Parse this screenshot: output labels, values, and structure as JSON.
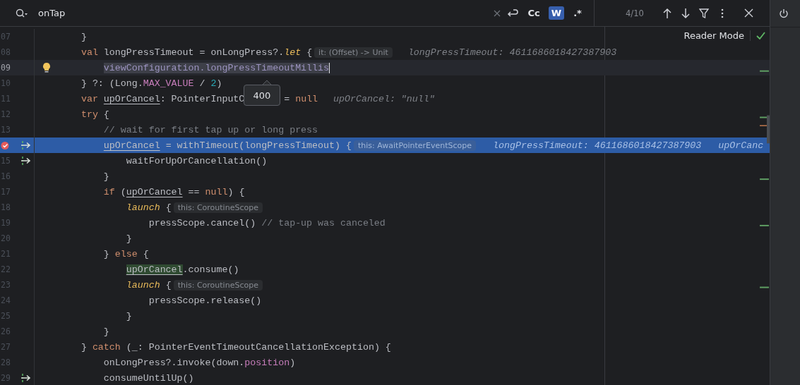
{
  "search": {
    "value": "onTap",
    "options": [
      {
        "label": "Cc",
        "selected": false
      },
      {
        "label": "W",
        "selected": true
      },
      {
        "label": ".*",
        "selected": false
      }
    ],
    "count": "4/10"
  },
  "reader_mode": {
    "label": "Reader Mode"
  },
  "tooltip": {
    "text": "400"
  },
  "lines": [
    {
      "number": "07",
      "current": false,
      "execution": false,
      "code": [
        {
          "kind": "plain",
          "text": "    }"
        }
      ]
    },
    {
      "number": "08",
      "current": false,
      "execution": false,
      "code": [
        {
          "kind": "keyword",
          "text": "    val "
        },
        {
          "kind": "plain",
          "text": "longPressTimeout = onLongPress?."
        },
        {
          "kind": "call",
          "text": "let"
        },
        {
          "kind": "plain",
          "text": " {"
        },
        {
          "kind": "hint",
          "text": "it: (Offset) -> Unit"
        },
        {
          "kind": "debug",
          "text": "longPressTimeout: 4611686018427387903"
        }
      ]
    },
    {
      "number": "09",
      "current": true,
      "execution": false,
      "markers": [
        {
          "kind": "bulb"
        }
      ],
      "code": [
        {
          "kind": "selected",
          "text": "        viewConfiguration.longPressTimeoutMillis"
        }
      ]
    },
    {
      "number": "10",
      "current": false,
      "execution": false,
      "code": [
        {
          "kind": "plain",
          "text": "    } ?: (Long."
        },
        {
          "kind": "constant",
          "text": "MAX_VALUE"
        },
        {
          "kind": "plain",
          "text": " / "
        },
        {
          "kind": "number",
          "text": "2"
        },
        {
          "kind": "plain",
          "text": ")"
        }
      ]
    },
    {
      "number": "11",
      "current": false,
      "execution": false,
      "code": [
        {
          "kind": "keyword",
          "text": "    var "
        },
        {
          "kind": "variable",
          "text": "upOrCancel"
        },
        {
          "kind": "plain",
          "text": ": PointerInputC"
        },
        {
          "kind": "plain",
          "text": "       = "
        },
        {
          "kind": "keyword",
          "text": "null"
        },
        {
          "kind": "debug",
          "text": "upOrCancel: \"null\""
        }
      ]
    },
    {
      "number": "12",
      "current": false,
      "execution": false,
      "code": [
        {
          "kind": "keyword",
          "text": "    try"
        },
        {
          "kind": "plain",
          "text": " {"
        }
      ]
    },
    {
      "number": "13",
      "current": false,
      "execution": false,
      "code": [
        {
          "kind": "comment",
          "text": "        // wait for first tap up or long press"
        }
      ]
    },
    {
      "current": false,
      "execution": true,
      "markers": [
        {
          "kind": "breakpoint"
        },
        {
          "kind": "step"
        }
      ],
      "code": [
        {
          "kind": "variable",
          "text": "        upOrCancel"
        },
        {
          "kind": "plain",
          "text": " = withTimeout(longPressTimeout) {"
        },
        {
          "kind": "hint",
          "text": "this: AwaitPointerEventScope"
        },
        {
          "kind": "debug",
          "text": "longPressTimeout: 4611686018427387903"
        },
        {
          "kind": "debug",
          "text": "upOrCanc"
        }
      ]
    },
    {
      "number": "15",
      "current": false,
      "execution": false,
      "markers": [
        {
          "kind": "step"
        }
      ],
      "code": [
        {
          "kind": "plain",
          "text": "            waitForUpOrCancellation()"
        }
      ]
    },
    {
      "number": "16",
      "current": false,
      "execution": false,
      "code": [
        {
          "kind": "plain",
          "text": "        }"
        }
      ]
    },
    {
      "number": "17",
      "current": false,
      "execution": false,
      "code": [
        {
          "kind": "keyword",
          "text": "        if"
        },
        {
          "kind": "plain",
          "text": " ("
        },
        {
          "kind": "variable",
          "text": "upOrCancel"
        },
        {
          "kind": "plain",
          "text": " == "
        },
        {
          "kind": "keyword",
          "text": "null"
        },
        {
          "kind": "plain",
          "text": ") {"
        }
      ]
    },
    {
      "number": "18",
      "current": false,
      "execution": false,
      "code": [
        {
          "kind": "call",
          "text": "            launch"
        },
        {
          "kind": "plain",
          "text": " {"
        },
        {
          "kind": "hint",
          "text": "this: CoroutineScope"
        }
      ]
    },
    {
      "number": "19",
      "current": false,
      "execution": false,
      "code": [
        {
          "kind": "plain",
          "text": "                pressScope.cancel() "
        },
        {
          "kind": "comment",
          "text": "// tap-up was canceled"
        }
      ]
    },
    {
      "number": "20",
      "current": false,
      "execution": false,
      "code": [
        {
          "kind": "plain",
          "text": "            }"
        }
      ]
    },
    {
      "number": "21",
      "current": false,
      "execution": false,
      "code": [
        {
          "kind": "plain",
          "text": "        } "
        },
        {
          "kind": "keyword",
          "text": "else"
        },
        {
          "kind": "plain",
          "text": " {"
        }
      ]
    },
    {
      "number": "22",
      "current": false,
      "execution": false,
      "code": [
        {
          "kind": "match",
          "text": "            upOrCancel"
        },
        {
          "kind": "plain",
          "text": ".consume()"
        }
      ]
    },
    {
      "number": "23",
      "current": false,
      "execution": false,
      "code": [
        {
          "kind": "call",
          "text": "            launch"
        },
        {
          "kind": "plain",
          "text": " {"
        },
        {
          "kind": "hint",
          "text": "this: CoroutineScope"
        }
      ]
    },
    {
      "number": "24",
      "current": false,
      "execution": false,
      "code": [
        {
          "kind": "plain",
          "text": "                pressScope.release()"
        }
      ]
    },
    {
      "number": "25",
      "current": false,
      "execution": false,
      "code": [
        {
          "kind": "plain",
          "text": "            }"
        }
      ]
    },
    {
      "number": "26",
      "current": false,
      "execution": false,
      "code": [
        {
          "kind": "plain",
          "text": "        }"
        }
      ]
    },
    {
      "number": "27",
      "current": false,
      "execution": false,
      "code": [
        {
          "kind": "plain",
          "text": "    } "
        },
        {
          "kind": "keyword",
          "text": "catch"
        },
        {
          "kind": "plain",
          "text": " (_: PointerEventTimeoutCancellationException) {"
        }
      ]
    },
    {
      "number": "28",
      "current": false,
      "execution": false,
      "code": [
        {
          "kind": "plain",
          "text": "        onLongPress?.invoke(down."
        },
        {
          "kind": "constant",
          "text": "position"
        },
        {
          "kind": "plain",
          "text": ")"
        }
      ]
    },
    {
      "number": "29",
      "current": false,
      "execution": false,
      "markers": [
        {
          "kind": "step"
        }
      ],
      "code": [
        {
          "kind": "plain",
          "text": "        consumeUntilUp()"
        }
      ]
    }
  ]
}
